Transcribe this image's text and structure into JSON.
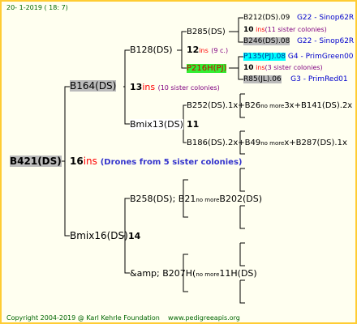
{
  "header": {
    "date": "20-  1-2019 ( 18:  7)"
  },
  "root": {
    "name": "B421(DS)",
    "count": "16",
    "ins": "ins",
    "note": "(Drones from 5 sister colonies)"
  },
  "gen1": [
    {
      "name": "B164(DS)",
      "count": "13",
      "ins": "ins",
      "note": "(10 sister colonies)"
    },
    {
      "name": "Bmix16(DS)",
      "count": "14"
    }
  ],
  "gen2": [
    {
      "name": "B128(DS)",
      "count": "12",
      "ins": "ins",
      "note": "(9 c.)"
    },
    {
      "name": "Bmix13(DS)",
      "count": "11"
    },
    {
      "name_a": "B258(DS); B21",
      "more": "no more",
      "name_b": "B202(DS)"
    },
    {
      "name_a": "&amp; B207H(",
      "more": "no more",
      "name_b": "11H(DS)"
    }
  ],
  "gen3": [
    {
      "name": "B285(DS)"
    },
    {
      "name": "P216H(PJ)"
    },
    {
      "name_a": "B252(DS).1x+B26",
      "more": "no more",
      "name_b": "3x+B141(DS).2x"
    },
    {
      "name_a": "B186(DS).2x+B49",
      "more": "no more",
      "name_b": "x+B287(DS).1x"
    }
  ],
  "gen4": [
    {
      "name": "B212(DS).09",
      "group": "G22 - Sinop62R"
    },
    {
      "count": "10",
      "ins": "ins",
      "note": "(11 sister colonies)"
    },
    {
      "name": "B246(DS).08",
      "group": "G22 - Sinop62R"
    },
    {
      "name": "P135(PJ).08",
      "group": "G4 - PrimGreen00"
    },
    {
      "count": "10",
      "ins": "ins",
      "note": "(3 sister colonies)"
    },
    {
      "name": "R85(JL).06",
      "group": "G3 - PrimRed01"
    }
  ],
  "footer": {
    "copyright": "Copyright 2004-2019 @ Karl Kehrle Foundation",
    "url": "www.pedigreeapis.org"
  }
}
